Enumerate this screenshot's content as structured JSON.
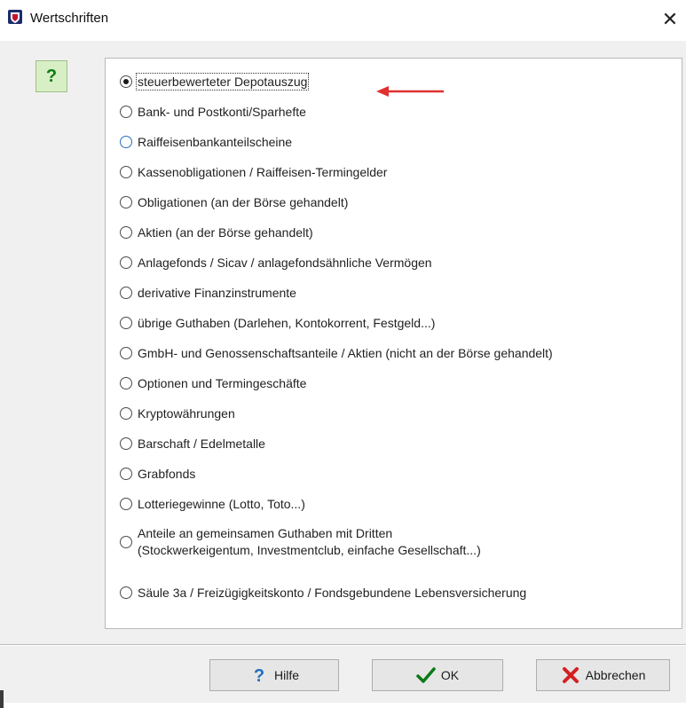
{
  "window": {
    "title": "Wertschriften",
    "close_glyph": "✕"
  },
  "help_icon": {
    "glyph": "?"
  },
  "options": [
    {
      "label": "steuerbewerteter Depotauszug",
      "checked": true
    },
    {
      "label": "Bank- und Postkonti/Sparhefte",
      "checked": false
    },
    {
      "label": "Raiffeisenbankanteilscheine",
      "checked": false
    },
    {
      "label": "Kassenobligationen / Raiffeisen-Termingelder",
      "checked": false
    },
    {
      "label": "Obligationen (an der Börse gehandelt)",
      "checked": false
    },
    {
      "label": "Aktien (an der Börse gehandelt)",
      "checked": false
    },
    {
      "label": "Anlagefonds / Sicav / anlagefondsähnliche Vermögen",
      "checked": false
    },
    {
      "label": "derivative Finanzinstrumente",
      "checked": false
    },
    {
      "label": "übrige Guthaben (Darlehen, Kontokorrent, Festgeld...)",
      "checked": false
    },
    {
      "label": "GmbH- und Genossenschaftsanteile / Aktien (nicht an der Börse gehandelt)",
      "checked": false
    },
    {
      "label": "Optionen und Termingeschäfte",
      "checked": false
    },
    {
      "label": "Kryptowährungen",
      "checked": false
    },
    {
      "label": "Barschaft / Edelmetalle",
      "checked": false
    },
    {
      "label": "Grabfonds",
      "checked": false
    },
    {
      "label": "Lotteriegewinne (Lotto, Toto...)",
      "checked": false
    },
    {
      "label_line1": "Anteile an gemeinsamen Guthaben mit Dritten",
      "label_line2": "(Stockwerkeigentum, Investmentclub, einfache Gesellschaft...)",
      "checked": false
    },
    {
      "label": "Säule 3a / Freizügigkeitskonto / Fondsgebundene Lebensversicherung",
      "checked": false
    }
  ],
  "buttons": {
    "help": "Hilfe",
    "ok": "OK",
    "cancel": "Abbrechen"
  },
  "colors": {
    "accent_green": "#0a7a16",
    "annotation_red": "#e03030",
    "cancel_red": "#d42020"
  },
  "icons": {
    "app": "app-icon",
    "help": "question-icon",
    "ok": "checkmark-icon",
    "cancel": "x-icon",
    "annotation": "red-arrow-icon"
  }
}
